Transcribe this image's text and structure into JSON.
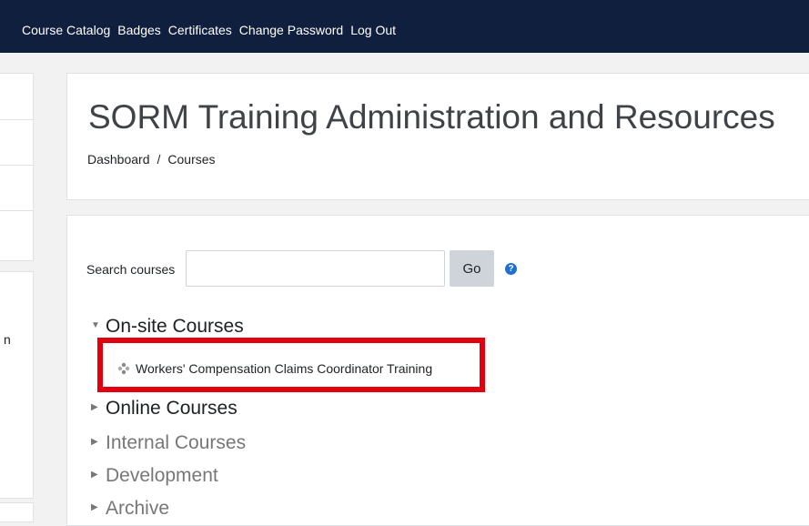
{
  "navbar": {
    "links": [
      "Course Catalog",
      "Badges",
      "Certificates",
      "Change Password",
      "Log Out"
    ]
  },
  "sidebar": {
    "fragment": "n"
  },
  "header": {
    "title": "SORM Training Administration and Resources",
    "breadcrumb": [
      "Dashboard",
      "Courses"
    ]
  },
  "search": {
    "label": "Search courses",
    "value": "",
    "button": "Go",
    "help_icon": "question-circle-icon"
  },
  "categories": [
    {
      "label": "On-site Courses",
      "expanded": true,
      "courses": [
        "Workers' Compensation Claims Coordinator Training"
      ]
    },
    {
      "label": "Online Courses",
      "expanded": false
    },
    {
      "label": "Internal Courses",
      "expanded": false
    },
    {
      "label": "Development",
      "expanded": false
    },
    {
      "label": "Archive",
      "expanded": false
    }
  ],
  "colors": {
    "navbar": "#0f1f3d",
    "highlight": "#e0000f",
    "help": "#1f6fd1"
  }
}
